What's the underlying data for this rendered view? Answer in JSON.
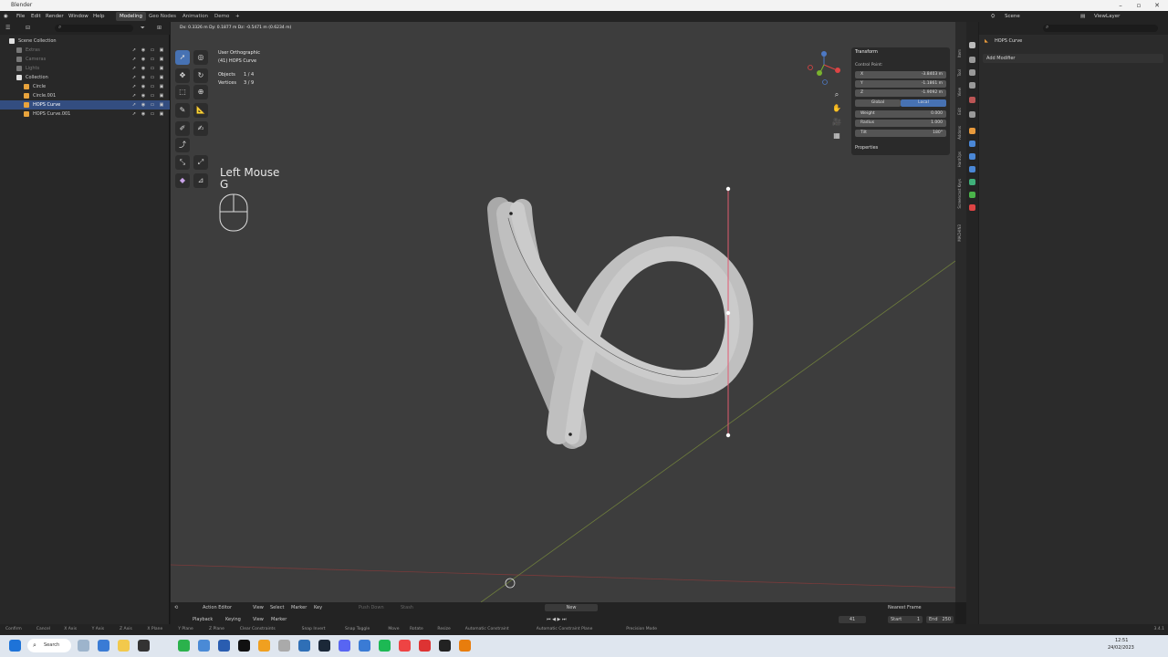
{
  "window": {
    "title": "Blender"
  },
  "menus": [
    "File",
    "Edit",
    "Render",
    "Window",
    "Help"
  ],
  "workspaces": [
    {
      "label": "Modeling",
      "active": true
    },
    {
      "label": "Geo Nodes",
      "active": false
    },
    {
      "label": "Animation",
      "active": false
    },
    {
      "label": "Demo",
      "active": false
    }
  ],
  "add_workspace": "+",
  "scene": {
    "label": "Scene",
    "viewlayer": "ViewLayer"
  },
  "outliner": {
    "rows": [
      {
        "name": "Scene Collection",
        "indent": 0,
        "state": "normal",
        "icon_color": "#e0e0e0"
      },
      {
        "name": "Extras",
        "indent": 1,
        "state": "dim",
        "icon_color": "#777777"
      },
      {
        "name": "Cameras",
        "indent": 1,
        "state": "dim",
        "icon_color": "#777777"
      },
      {
        "name": "Lights",
        "indent": 1,
        "state": "dim",
        "icon_color": "#777777"
      },
      {
        "name": "Collection",
        "indent": 1,
        "state": "normal",
        "icon_color": "#e0e0e0"
      },
      {
        "name": "Circle",
        "indent": 2,
        "state": "normal",
        "icon_color": "#e8a33c"
      },
      {
        "name": "Circle.001",
        "indent": 2,
        "state": "normal",
        "icon_color": "#e8a33c"
      },
      {
        "name": "HOPS Curve",
        "indent": 2,
        "state": "selected",
        "icon_color": "#e8a33c"
      },
      {
        "name": "HOPS Curve.001",
        "indent": 2,
        "state": "normal",
        "icon_color": "#e8a33c"
      }
    ]
  },
  "viewport": {
    "header_readout": "Dx: 0.3326 m  Dy: 0.1877 m  Dz: -0.5471 m (0.6234 m)",
    "view_name": "User Orthographic",
    "object_name": "(41) HOPS Curve",
    "objects_label": "Objects",
    "objects_value": "1 / 4",
    "vertices_label": "Vertices",
    "vertices_value": "3 / 9",
    "key_hint_1": "Left Mouse",
    "key_hint_2": "G"
  },
  "n_panel": {
    "section": "Transform",
    "subsection": "Control Point:",
    "fields": [
      {
        "key": "X",
        "value": "-3.8403 m"
      },
      {
        "key": "Y",
        "value": "-1.1861 m"
      },
      {
        "key": "Z",
        "value": "-1.9092 m"
      }
    ],
    "toggle": {
      "left": "Global",
      "right": "Local"
    },
    "extra_fields": [
      {
        "key": "Weight",
        "value": "0.000"
      },
      {
        "key": "Radius",
        "value": "1.000"
      },
      {
        "key": "Tilt",
        "value": "180°"
      }
    ],
    "properties_label": "Properties"
  },
  "side_tabs": [
    "Item",
    "Tool",
    "View",
    "Edit",
    "Addons",
    "HardOps",
    "Screencast Keys",
    "MACHIN3"
  ],
  "properties": {
    "object_name": "HOPS Curve",
    "add_modifier": "Add Modifier"
  },
  "timeline": {
    "mode": "Action Editor",
    "menu": [
      "View",
      "Select",
      "Marker",
      "Key"
    ],
    "push_down": "Push Down",
    "stash": "Stash",
    "new_label": "New",
    "snap": "Nearest Frame",
    "playback": [
      "Playback",
      "Keying",
      "View",
      "Marker"
    ],
    "current_frame": "41",
    "start_label": "Start",
    "start_value": "1",
    "end_label": "End",
    "end_value": "250"
  },
  "statusbar": {
    "items": [
      "Confirm",
      "Cancel",
      "X Axis",
      "Y Axis",
      "Z Axis",
      "X Plane",
      "Y Plane",
      "Z Plane",
      "Clear Constraints",
      "Snap Invert",
      "Snap Toggle",
      "Move",
      "Rotate",
      "Resize",
      "Automatic Constraint",
      "Automatic Constraint Plane",
      "Precision Mode"
    ],
    "version": "3.4.1"
  },
  "taskbar": {
    "search": "Search",
    "time": "12:51",
    "date": "24/02/2023"
  },
  "colors": {
    "accent": "#4772b3",
    "selection": "#334d80",
    "viewport": "#3d3d3d",
    "panel": "#282828"
  }
}
